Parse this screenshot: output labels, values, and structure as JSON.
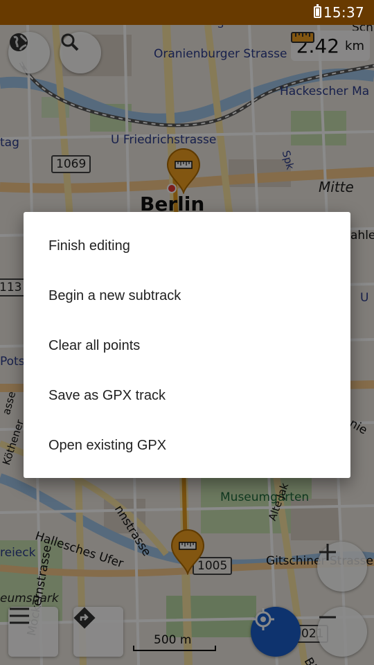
{
  "status_bar": {
    "time": "15:37"
  },
  "map": {
    "labels": {
      "oranienburger": "Oranienburger Strasse",
      "hackescher": "Hackescher Ma",
      "friedrichstrasse": "U Friedrichstrasse",
      "berlin": "Berlin",
      "mitte": "Mitte",
      "spk": "Spk",
      "stag": "tag",
      "potsd": "Pots",
      "ahler": "ahler",
      "u_right": "U",
      "museumsgarten": "Museumgarten",
      "hallesches_ufer": "Hallesches Ufer",
      "gitschiner": "Gitschiner Strasse",
      "reieck": "reieck",
      "eumspark": "eumspark",
      "mockernstrasse": "Möckernstrasse",
      "koethener": "Köthener",
      "wilhelmstrasse": "nnstrasse",
      "alte_jakob": "Alte Jak",
      "granie": "anie",
      "schr": "Schr",
      "bl": "Bl",
      "s_top": "S",
      "gasse": "asse"
    },
    "shields": {
      "r1069": "1069",
      "r1005": "1005",
      "r113": "113",
      "r021": "021"
    },
    "scale_text": "500 m",
    "ruler": {
      "distance": "2.42",
      "unit": "km"
    }
  },
  "menu": {
    "items": [
      "Finish editing",
      "Begin a new subtrack",
      "Clear all points",
      "Save as GPX track",
      "Open existing GPX"
    ]
  },
  "colors": {
    "status_bar": "#683a00",
    "accent": "#f0a020",
    "locate_button": "#1a5fcb"
  }
}
